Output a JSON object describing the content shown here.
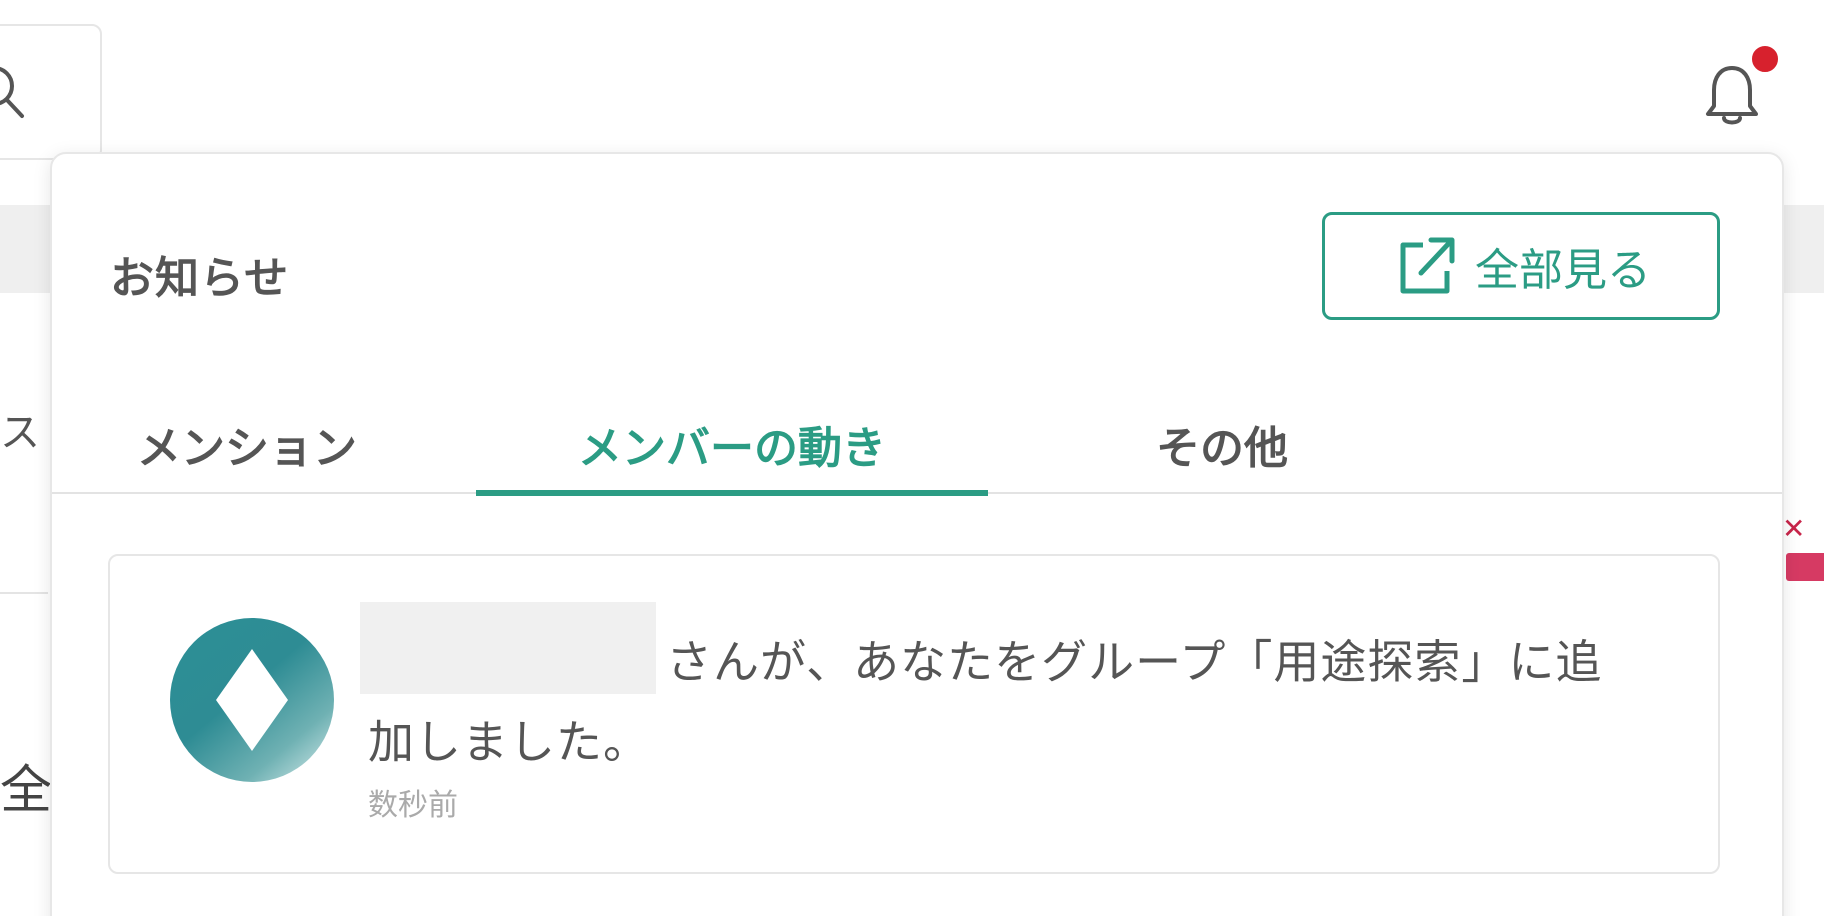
{
  "background": {
    "left_text_1": "ス",
    "left_text_2": "全"
  },
  "header": {
    "bell_icon": "bell-icon",
    "has_unread": true,
    "unread_dot_color": "#d7212d"
  },
  "notifications_panel": {
    "title": "お知らせ",
    "view_all": {
      "label": "全部見る",
      "icon": "external-link-icon"
    },
    "tabs": [
      {
        "label": "メンション",
        "active": false
      },
      {
        "label": "メンバーの動き",
        "active": true
      },
      {
        "label": "その他",
        "active": false
      }
    ],
    "items": [
      {
        "avatar_icon": "diamond-icon",
        "name_redacted": true,
        "message_line1": "さんが、あなたをグループ「用途探索」に追",
        "message_line2": "加しました。",
        "time": "数秒前"
      }
    ]
  },
  "colors": {
    "accent": "#2b9c84",
    "text": "#555555",
    "muted": "#aaaaaa",
    "border": "#e6e6e6"
  }
}
